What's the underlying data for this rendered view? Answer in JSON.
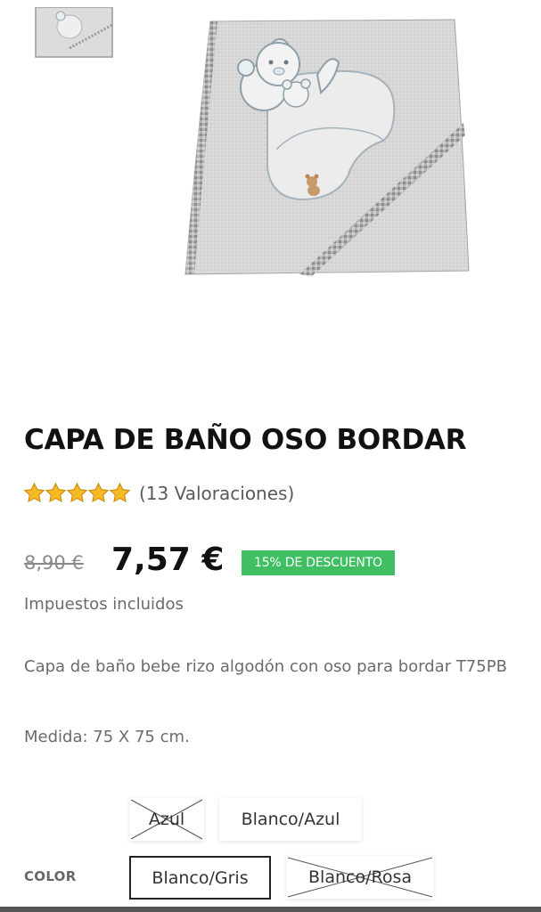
{
  "product": {
    "title": "CAPA DE BAÑO OSO BORDAR",
    "rating_stars": 5,
    "reviews": "(13 Valoraciones)",
    "old_price": "8,90 €",
    "price": "7,57 €",
    "discount_badge": "15% DE DESCUENTO",
    "tax_note": "Impuestos incluidos",
    "description": "Capa de baño bebe rizo algodón con oso para bordar T75PB",
    "measure": "Medida: 75 X 75 cm."
  },
  "colors": {
    "accent_green": "#3fbf62",
    "star_fill": "#f7b924"
  },
  "color_selector": {
    "label": "COLOR",
    "options": [
      {
        "label": "Azul",
        "available": false,
        "selected": false
      },
      {
        "label": "Blanco/Azul",
        "available": true,
        "selected": false
      },
      {
        "label": "Blanco/Gris",
        "available": true,
        "selected": true
      },
      {
        "label": "Blanco/Rosa",
        "available": false,
        "selected": false
      }
    ]
  }
}
